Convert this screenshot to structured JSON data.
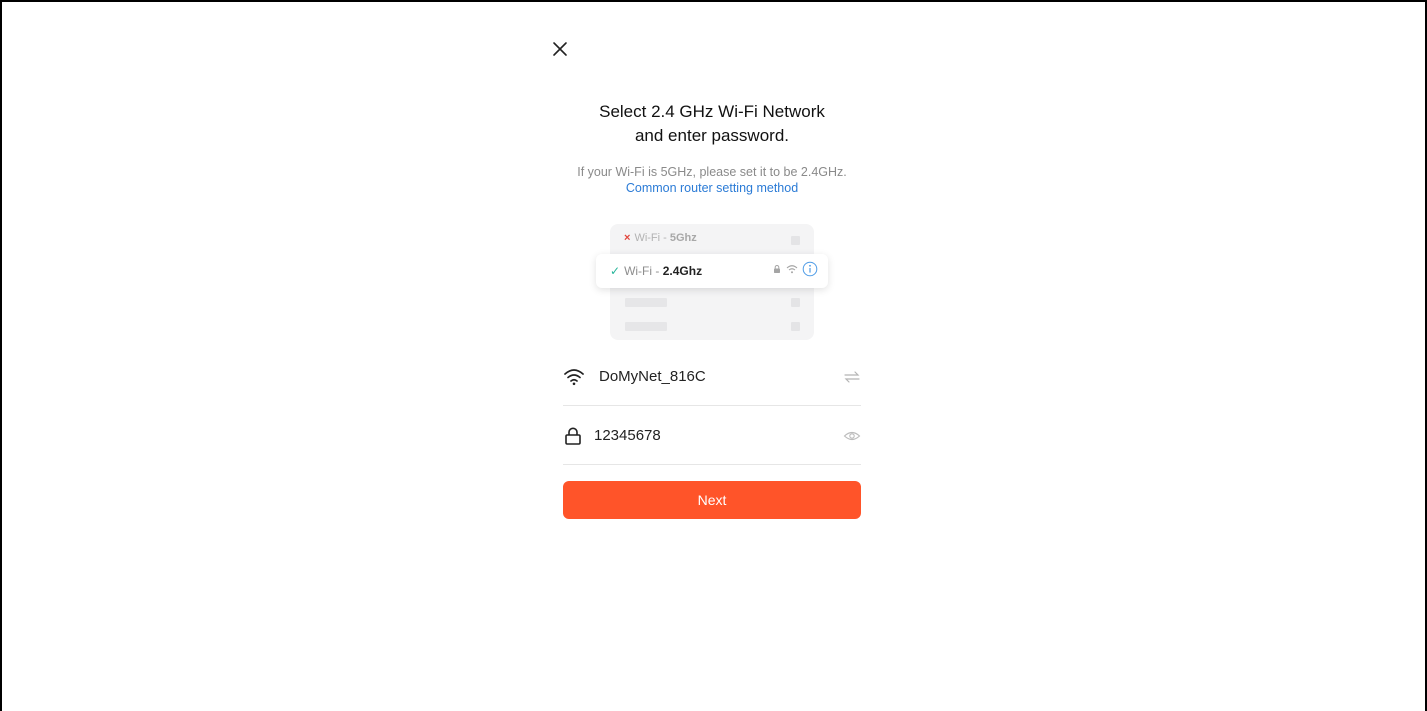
{
  "header": {
    "close_icon": "close-icon"
  },
  "title": {
    "line1": "Select 2.4 GHz Wi-Fi Network",
    "line2": "and enter password."
  },
  "hint": {
    "text": "If your Wi-Fi is 5GHz, please set it to be 2.4GHz.",
    "link_label": "Common router setting method",
    "link_color": "#2b7bd6"
  },
  "illustration": {
    "bad": {
      "mark": "×",
      "prefix": "Wi-Fi - ",
      "band": "5Ghz"
    },
    "good": {
      "mark": "✓",
      "prefix": "Wi-Fi - ",
      "band": "2.4Ghz"
    }
  },
  "network": {
    "ssid": "DoMyNet_816C",
    "icon": "wifi-icon",
    "switch_icon": "swap-icon"
  },
  "password": {
    "value": "12345678",
    "icon": "lock-icon",
    "toggle_icon": "eye-icon"
  },
  "actions": {
    "next_label": "Next",
    "next_color": "#ff5429"
  }
}
